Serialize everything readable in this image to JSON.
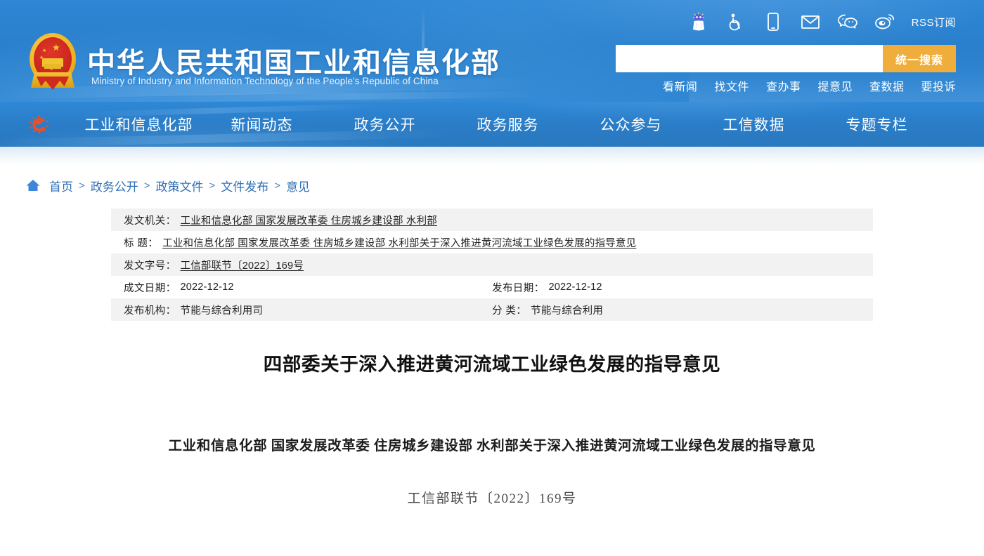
{
  "header": {
    "title_cn": "中华人民共和国工业和信息化部",
    "title_en": "Ministry of Industry and Information Technology of the People's Republic of China",
    "emblem_name": "national-emblem",
    "util_icons": [
      {
        "name": "mascot-robot-icon",
        "label": "智能助手"
      },
      {
        "name": "accessibility-icon",
        "label": "无障碍"
      },
      {
        "name": "mobile-phone-icon",
        "label": "手机版"
      },
      {
        "name": "email-icon",
        "label": "邮箱"
      },
      {
        "name": "wechat-icon",
        "label": "微信"
      },
      {
        "name": "weibo-icon",
        "label": "微博"
      }
    ],
    "rss_label": "RSS订阅",
    "search": {
      "value": "",
      "placeholder": "",
      "button_label": "统一搜索",
      "button_color": "#efad3c"
    },
    "quick_links": [
      "看新闻",
      "找文件",
      "查办事",
      "提意见",
      "查数据",
      "要投诉"
    ],
    "bg_color": "#2a80cd"
  },
  "nav": {
    "logo_name": "miit-logo-icon",
    "items": [
      "工业和信息化部",
      "新闻动态",
      "政务公开",
      "政务服务",
      "公众参与",
      "工信数据",
      "专题专栏"
    ],
    "bg_color": "#2a7cc6"
  },
  "breadcrumb": {
    "home_icon": "home-icon",
    "items": [
      "首页",
      "政务公开",
      "政策文件",
      "文件发布",
      "意见"
    ],
    "separator": ">",
    "link_color": "#2f6fb5"
  },
  "meta": {
    "rows": [
      {
        "shade": true,
        "cells": [
          {
            "label": "发文机关：",
            "value": "工业和信息化部 国家发展改革委 住房城乡建设部 水利部",
            "link": true,
            "span": 2
          }
        ]
      },
      {
        "shade": false,
        "cells": [
          {
            "label": "标    题：",
            "value": "工业和信息化部 国家发展改革委 住房城乡建设部 水利部关于深入推进黄河流域工业绿色发展的指导意见",
            "link": true,
            "span": 2
          }
        ]
      },
      {
        "shade": true,
        "cells": [
          {
            "label": "发文字号：",
            "value": "工信部联节〔2022〕169号",
            "link": true,
            "span": 2
          }
        ]
      },
      {
        "shade": false,
        "cells": [
          {
            "label": "成文日期：",
            "value": "2022-12-12",
            "link": false,
            "span": 1
          },
          {
            "label": "发布日期：",
            "value": "2022-12-12",
            "link": false,
            "span": 1
          }
        ]
      },
      {
        "shade": true,
        "cells": [
          {
            "label": "发布机构：",
            "value": "节能与综合利用司",
            "link": false,
            "span": 1
          },
          {
            "label": "分    类：",
            "value": "节能与综合利用",
            "link": false,
            "span": 1
          }
        ]
      }
    ]
  },
  "article": {
    "title": "四部委关于深入推进黄河流域工业绿色发展的指导意见",
    "heading": "工业和信息化部  国家发展改革委  住房城乡建设部  水利部关于深入推进黄河流域工业绿色发展的指导意见",
    "doc_number": "工信部联节〔2022〕169号"
  }
}
